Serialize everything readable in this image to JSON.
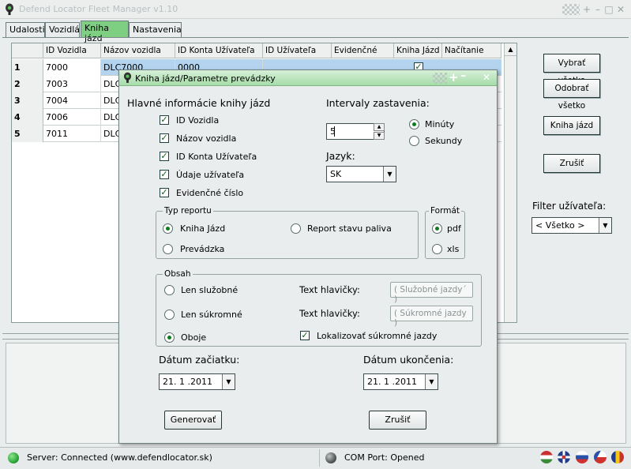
{
  "window": {
    "title": "Defend Locator Fleet Manager v1.10"
  },
  "tabs": [
    {
      "label": "Udalosti"
    },
    {
      "label": "Vozidlá"
    },
    {
      "label": "Kniha jázd"
    },
    {
      "label": "Nastavenia"
    }
  ],
  "grid": {
    "columns": [
      "ID Vozidla",
      "Názov vozidla",
      "ID Konta Užívateľa",
      "ID Užívateľa",
      "Evidenčné",
      "Kniha Jázd",
      "Načítanie"
    ],
    "rows": [
      {
        "idx": "1",
        "id": "7000",
        "name": "DLC7000",
        "account": "0000"
      },
      {
        "idx": "2",
        "id": "7003",
        "name": "DLC",
        "account": ""
      },
      {
        "idx": "3",
        "id": "7004",
        "name": "DLC",
        "account": ""
      },
      {
        "idx": "4",
        "id": "7006",
        "name": "DLC",
        "account": ""
      },
      {
        "idx": "5",
        "id": "7011",
        "name": "DLC",
        "account": ""
      }
    ]
  },
  "right_panel": {
    "select_all": "Vybrať všetko",
    "deselect_all": "Odobrať všetko",
    "logbook": "Kniha jázd",
    "cancel": "Zrušiť",
    "filter_label": "Filter užívateľa:",
    "filter_value": "< Všetko >"
  },
  "dialog": {
    "title": "Kniha jázd/Parametre prevádzky",
    "main_info": {
      "heading": "Hlavné informácie knihy jázd",
      "items": [
        {
          "label": "ID Vozidla",
          "checked": true
        },
        {
          "label": "Názov vozidla",
          "checked": true
        },
        {
          "label": "ID Konta Užívateľa",
          "checked": true
        },
        {
          "label": "Údaje užívateľa",
          "checked": true
        },
        {
          "label": "Evidenčné číslo",
          "checked": true
        }
      ]
    },
    "intervals": {
      "heading": "Intervaly zastavenia:",
      "value": "5",
      "unit_minutes": "Minúty",
      "unit_seconds": "Sekundy",
      "selected": "Minúty"
    },
    "language": {
      "label": "Jazyk:",
      "value": "SK"
    },
    "report_type": {
      "title": "Typ reportu",
      "option_logbook": "Kniha Jázd",
      "option_fuel": "Report stavu paliva",
      "option_operation": "Prevádzka",
      "selected": "Kniha Jázd"
    },
    "format": {
      "title": "Formát",
      "pdf": "pdf",
      "xls": "xls",
      "selected": "pdf"
    },
    "content": {
      "title": "Obsah",
      "option_business": "Len služobné",
      "option_private": "Len súkromné",
      "option_both": "Oboje",
      "selected": "Oboje",
      "header_label_1": "Text hlavičky:",
      "header_value_1": "( Služobné jazdy´ )",
      "header_label_2": "Text hlavičky:",
      "header_value_2": "( Súkromné jazdy )",
      "localize_label": "Lokalizovať súkromné jazdy",
      "localize_checked": true
    },
    "date_start": {
      "label": "Dátum začiatku:",
      "value": "21. 1 .2011"
    },
    "date_end": {
      "label": "Dátum ukončenia:",
      "value": "21. 1 .2011"
    },
    "generate": "Generovať",
    "cancel": "Zrušiť"
  },
  "status": {
    "server": "Server: Connected (www.defendlocator.sk)",
    "server_color": "#2fa83a",
    "com": "COM Port: Opened",
    "com_color": "#555a5a",
    "flags": [
      "flag-hu-icon",
      "flag-uk-icon",
      "flag-sk-icon",
      "flag-cz-icon",
      "flag-ro-icon"
    ]
  }
}
